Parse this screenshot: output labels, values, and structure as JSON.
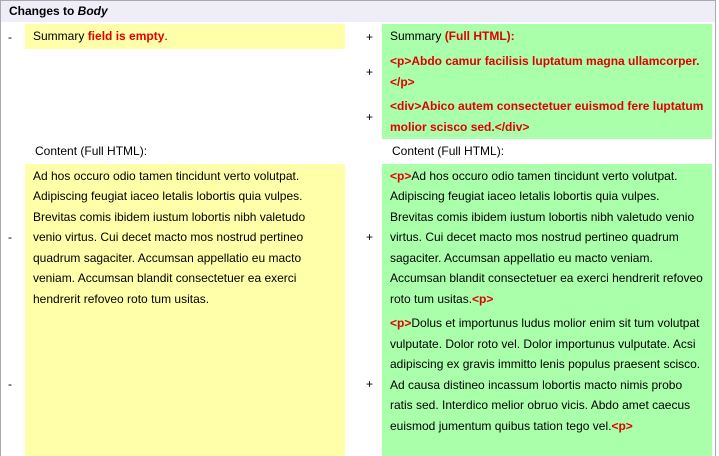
{
  "header": {
    "prefix": "Changes to ",
    "field": "Body"
  },
  "colors": {
    "removed_bg": "#ffffaa",
    "added_bg": "#aaffaa",
    "changed_text": "#e00000",
    "header_bg": "#efeef8"
  },
  "diff": {
    "row1": {
      "old_marker": "-",
      "old_pre": "Summary ",
      "old_changed": "field is empty",
      "old_post": ".",
      "new_marker": "+",
      "new_pre": "Summary ",
      "new_changed": "(Full HTML):"
    },
    "row2": {
      "new_marker": "+",
      "new_changed": "<p>Abdo camur facilisis luptatum magna ullamcorper.</p>"
    },
    "row3": {
      "new_marker": "+",
      "new_changed": "<div>Abico autem consectetuer euismod fere luptatum molior scisco sed.</div>"
    },
    "row4": {
      "old_label": "Content (Full HTML):",
      "new_label": "Content (Full HTML):"
    },
    "row5": {
      "old_marker": "-",
      "old_text": "Ad hos occuro odio tamen tincidunt verto volutpat. Adipiscing feugiat iaceo letalis lobortis quia vulpes. Brevitas comis ibidem iustum lobortis nibh valetudo venio virtus. Cui decet macto mos nostrud pertineo quadrum sagaciter. Accumsan appellatio eu macto veniam. Accumsan blandit consectetuer ea exerci hendrerit refoveo roto tum usitas.",
      "new_marker": "+",
      "new_open_tag": "<p>",
      "new_text": "Ad hos occuro odio tamen tincidunt verto volutpat. Adipiscing feugiat iaceo letalis lobortis quia vulpes. Brevitas comis ibidem iustum lobortis nibh valetudo venio virtus. Cui decet macto mos nostrud pertineo quadrum sagaciter. Accumsan appellatio eu macto veniam. Accumsan blandit consectetuer ea exerci hendrerit refoveo roto tum usitas.",
      "new_close_tag": "<p>"
    },
    "row6": {
      "old_marker": "-",
      "new_marker": "+",
      "new_open_tag": "<p>",
      "new_text": "Dolus et importunus ludus molior enim sit tum volutpat vulputate. Dolor roto vel. Dolor importunus vulputate. Acsi adipiscing ex gravis immitto lenis populus praesent scisco. Ad causa distineo incassum lobortis macto nimis probo ratis sed. Interdico melior obruo vicis. Abdo amet caecus euismod jumentum quibus tation tego vel.",
      "new_close_tag": "<p>"
    }
  }
}
